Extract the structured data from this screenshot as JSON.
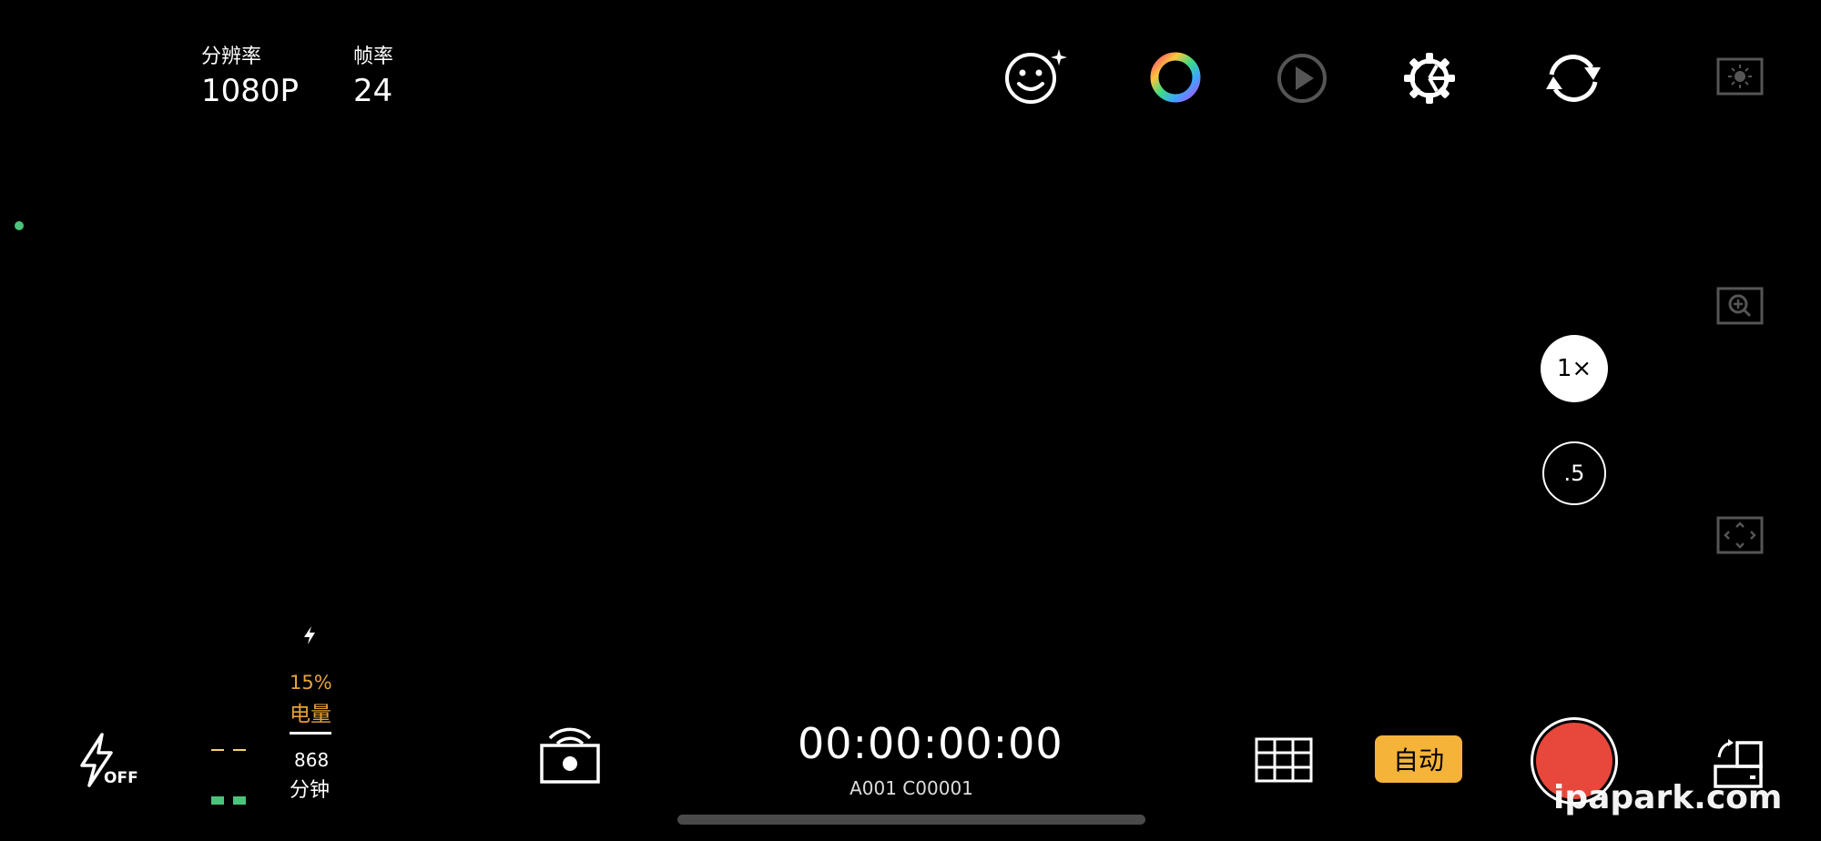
{
  "top_left": {
    "resolution": {
      "label": "分辨率",
      "value": "1080P"
    },
    "framerate": {
      "label": "帧率",
      "value": "24"
    }
  },
  "top_toolbar": {
    "icons": [
      "face-sparkle-icon",
      "color-ring-icon",
      "playback-icon",
      "settings-gear-icon",
      "switch-camera-icon"
    ]
  },
  "right_rail": {
    "icons": [
      "exposure-icon",
      "zoom-in-icon",
      "frame-guide-icon"
    ],
    "zoom_levels": [
      {
        "label": "1×",
        "active": true
      },
      {
        "label": ".5",
        "active": false
      }
    ]
  },
  "status": {
    "charging_icon": "lightning-icon",
    "battery_percent": "15%",
    "battery_label": "电量",
    "minutes_value": "868",
    "minutes_label": "分钟"
  },
  "bottom_bar": {
    "flash_state": "OFF",
    "timecode": "00:00:00:00",
    "clip_name": "A001 C00001",
    "auto_label": "自动",
    "icons": [
      "flash-off-icon",
      "remote-camera-icon",
      "grid-icon",
      "rotate-lock-icon"
    ]
  },
  "colors": {
    "accent_yellow": "#f5b33a",
    "record_red": "#e8473c",
    "battery_orange": "#e6a23c",
    "level_green": "#4cc37a",
    "dim_icon": "#555555"
  },
  "watermark": "ipapark.com"
}
